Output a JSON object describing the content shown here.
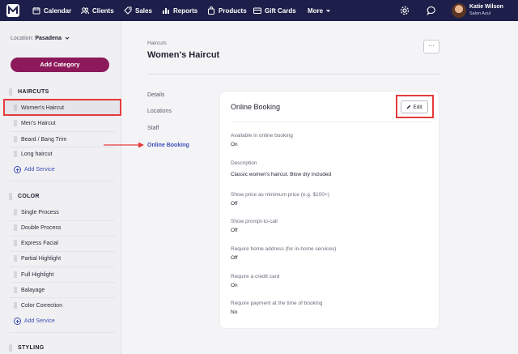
{
  "topnav": {
    "items": [
      {
        "label": "Calendar",
        "icon": "calendar-icon"
      },
      {
        "label": "Clients",
        "icon": "clients-icon"
      },
      {
        "label": "Sales",
        "icon": "sales-tag-icon"
      },
      {
        "label": "Reports",
        "icon": "reports-icon"
      },
      {
        "label": "Products",
        "icon": "products-bag-icon"
      },
      {
        "label": "Gift Cards",
        "icon": "gift-card-icon"
      },
      {
        "label": "More",
        "icon": "chevron-down-icon"
      }
    ],
    "user_name": "Katie Wilson",
    "user_business": "Salon Azul",
    "bg_color": "#1d1f4a"
  },
  "sidebar": {
    "location_label": "Location:",
    "location_value": "Pasadena",
    "add_category_label": "Add Category",
    "accent_color": "#8c1a5a",
    "categories": [
      {
        "name": "HAIRCUTS",
        "services": [
          "Women's Haircut",
          "Men's Haircut",
          "Beard / Bang Trim",
          "Long haircut"
        ],
        "add_label": "Add Service"
      },
      {
        "name": "COLOR",
        "services": [
          "Single Process",
          "Double Process",
          "Express Facial",
          "Partial Highlight",
          "Full Highlight",
          "Balayage",
          "Color Correction"
        ],
        "add_label": "Add Service"
      },
      {
        "name": "STYLING",
        "services": [],
        "add_label": ""
      }
    ]
  },
  "main": {
    "breadcrumb": "Haircuts",
    "title": "Women's Haircut",
    "more_label": "···",
    "tabs": [
      {
        "label": "Details",
        "active": false
      },
      {
        "label": "Locations",
        "active": false
      },
      {
        "label": "Staff",
        "active": false
      },
      {
        "label": "Online Booking",
        "active": true
      }
    ],
    "card": {
      "title": "Online Booking",
      "edit_label": "Edit",
      "fields": [
        {
          "label": "Available in online booking",
          "value": "On"
        },
        {
          "label": "Description",
          "value": "Classic women's haircut. Blow dry included"
        },
        {
          "label": "Show price as minimum price (e.g. $100+)",
          "value": "Off"
        },
        {
          "label": "Show prompt-to-call",
          "value": "Off"
        },
        {
          "label": "Require home address (for in-home services)",
          "value": "Off"
        },
        {
          "label": "Require a credit card",
          "value": "On"
        },
        {
          "label": "Require payment at the time of booking",
          "value": "No"
        }
      ]
    },
    "annotation_color": "#e53b3b"
  }
}
